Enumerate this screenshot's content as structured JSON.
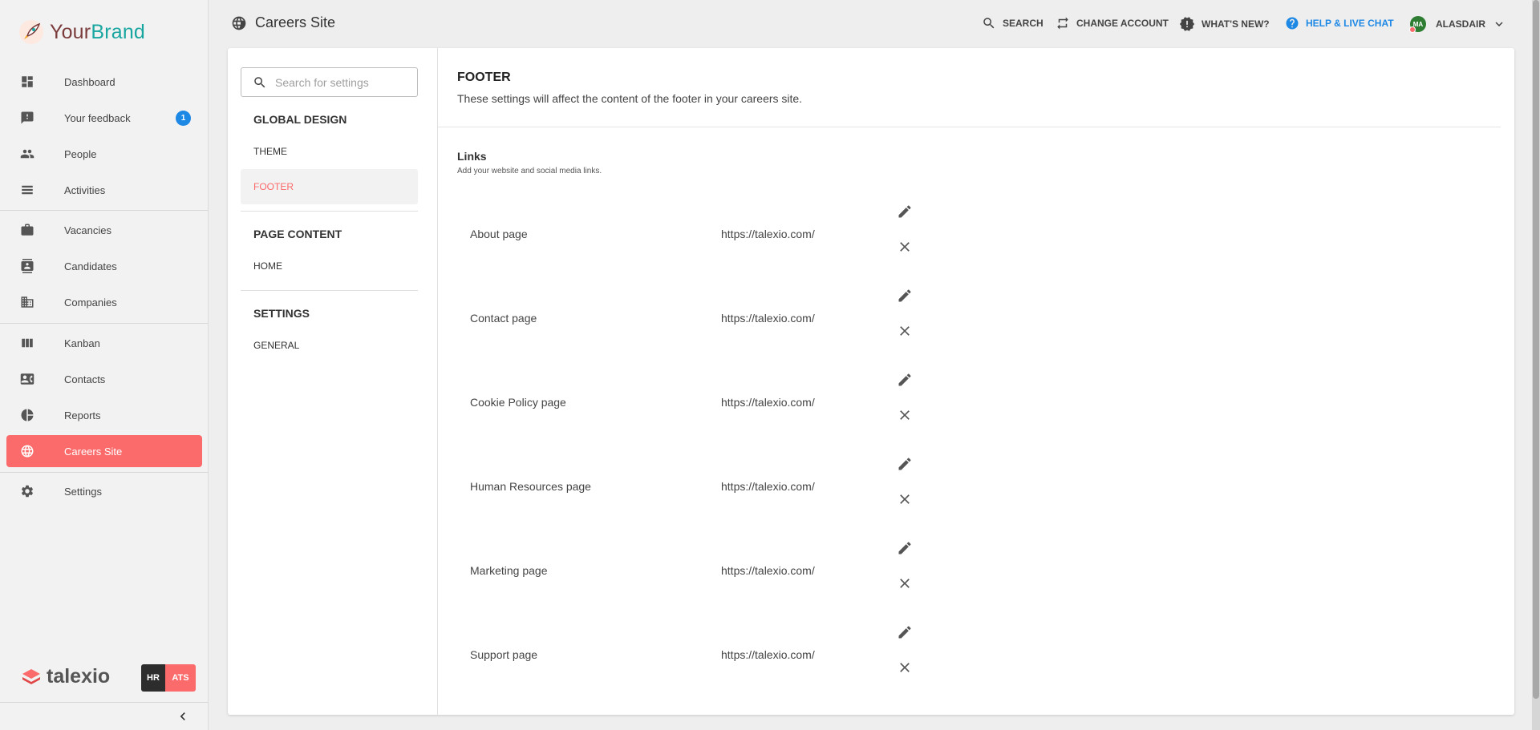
{
  "brand": {
    "name_part1": "Your",
    "name_part2": "Brand"
  },
  "sidebar": {
    "items": [
      {
        "label": "Dashboard",
        "icon": "dashboard-icon"
      },
      {
        "label": "Your feedback",
        "icon": "feedback-icon",
        "badge": "1"
      },
      {
        "label": "People",
        "icon": "people-icon"
      },
      {
        "label": "Activities",
        "icon": "activities-icon"
      },
      {
        "label": "Vacancies",
        "icon": "briefcase-icon"
      },
      {
        "label": "Candidates",
        "icon": "candidate-icon"
      },
      {
        "label": "Companies",
        "icon": "building-icon"
      },
      {
        "label": "Kanban",
        "icon": "kanban-icon"
      },
      {
        "label": "Contacts",
        "icon": "contact-card-icon"
      },
      {
        "label": "Reports",
        "icon": "pie-chart-icon"
      },
      {
        "label": "Careers Site",
        "icon": "globe-icon",
        "active": true
      },
      {
        "label": "Settings",
        "icon": "gear-icon"
      }
    ],
    "footer_logo": "talexio",
    "hr_label": "HR",
    "ats_label": "ATS"
  },
  "header": {
    "title": "Careers Site",
    "search": "SEARCH",
    "change_account": "CHANGE ACCOUNT",
    "whats_new": "WHAT'S NEW?",
    "help": "HELP & LIVE CHAT",
    "avatar_initials": "MA",
    "user": "ALASDAIR"
  },
  "settings_nav": {
    "search_placeholder": "Search for settings",
    "sections": [
      {
        "heading": "GLOBAL DESIGN",
        "items": [
          "THEME",
          "FOOTER"
        ]
      },
      {
        "heading": "PAGE CONTENT",
        "items": [
          "HOME"
        ]
      },
      {
        "heading": "SETTINGS",
        "items": [
          "GENERAL"
        ]
      }
    ],
    "active_item": "FOOTER"
  },
  "content": {
    "title": "FOOTER",
    "description": "These settings will affect the content of the footer in your careers site.",
    "links_title": "Links",
    "links_description": "Add your website and social media links.",
    "links": [
      {
        "name": "About page",
        "url": "https://talexio.com/"
      },
      {
        "name": "Contact page",
        "url": "https://talexio.com/"
      },
      {
        "name": "Cookie Policy page",
        "url": "https://talexio.com/"
      },
      {
        "name": "Human Resources page",
        "url": "https://talexio.com/"
      },
      {
        "name": "Marketing page",
        "url": "https://talexio.com/"
      },
      {
        "name": "Support page",
        "url": "https://talexio.com/"
      }
    ]
  },
  "colors": {
    "accent": "#fb6b6b",
    "help_blue": "#1e88e5",
    "brand_teal": "#1aa6a0"
  }
}
